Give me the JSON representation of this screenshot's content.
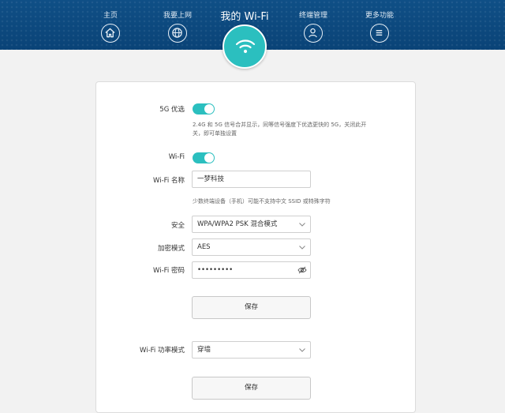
{
  "nav": {
    "items": [
      {
        "label": "主页",
        "icon": "home-icon"
      },
      {
        "label": "我要上网",
        "icon": "globe-icon"
      },
      {
        "label": "终端管理",
        "icon": "user-icon"
      },
      {
        "label": "更多功能",
        "icon": "menu-icon"
      }
    ],
    "active_title": "我的 Wi-Fi",
    "active_icon": "wifi-icon",
    "colors": {
      "header": "#0a4377",
      "accent": "#2bbfbf"
    }
  },
  "form": {
    "pref5g_label": "5G 优选",
    "pref5g_on": true,
    "pref5g_note_line1": "2.4G 和 5G 信号合并显示，同等信号强度下优选更快的 5G，关闭此开",
    "pref5g_note_line2": "关，即可单独设置",
    "wifi_label": "Wi-Fi",
    "wifi_on": true,
    "name_label": "Wi-Fi 名称",
    "name_value": "一梦科技",
    "name_note": "少数终端设备（手机）可能不支持中文 SSID 或特殊字符",
    "security_label": "安全",
    "security_value": "WPA/WPA2 PSK 混合模式",
    "encryption_label": "加密模式",
    "encryption_value": "AES",
    "password_label": "Wi-Fi 密码",
    "password_value": "•••••••••",
    "save_label": "保存",
    "power_label": "Wi-Fi 功率模式",
    "power_value": "穿墙",
    "save2_label": "保存"
  }
}
